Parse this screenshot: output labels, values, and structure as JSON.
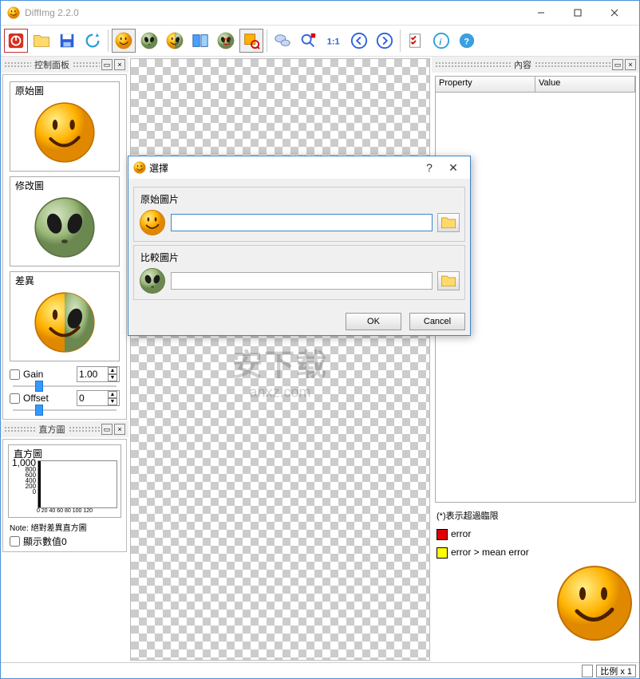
{
  "app": {
    "title": "DiffImg 2.2.0"
  },
  "toolbar_icons": {
    "power": "power-icon",
    "open": "folder-open-icon",
    "save": "save-icon",
    "refresh": "refresh-icon",
    "smile": "smiley-icon",
    "alien": "alien-icon",
    "diff": "diff-icon",
    "split": "split-view-icon",
    "overlay": "overlay-icon",
    "zoomrect": "zoom-rect-icon",
    "comment": "comment-icon",
    "zoom": "zoom-icon",
    "onetoone": "one-to-one-icon",
    "prev": "prev-icon",
    "next": "next-icon",
    "check": "checklist-icon",
    "info": "info-icon",
    "help": "help-icon"
  },
  "panels": {
    "control": "控制面板",
    "content": "內容",
    "histogram": "直方圖"
  },
  "thumbs": {
    "orig": "原始圖",
    "modified": "修改圖",
    "diff": "差異"
  },
  "controls": {
    "gain_label": "Gain",
    "gain_value": "1.00",
    "offset_label": "Offset",
    "offset_value": "0"
  },
  "histogram": {
    "title": "直方圖",
    "ymax": "1,000",
    "note": "Note: 絕對差異直方圖",
    "show0": "顯示數值0"
  },
  "properties": {
    "col1": "Property",
    "col2": "Value"
  },
  "legend": {
    "hint": "(*)表示超過臨限",
    "err": "error",
    "errmean": "error > mean error"
  },
  "status": {
    "scale": "比例 x 1"
  },
  "dialog": {
    "title": "選擇",
    "orig": "原始圖片",
    "compare": "比較圖片",
    "input1": "",
    "input2": "",
    "ok": "OK",
    "cancel": "Cancel"
  },
  "watermark": {
    "cn": "安下载",
    "en": "anxz.com"
  },
  "colors": {
    "red": "#e00000",
    "yellow": "#ffff00"
  }
}
